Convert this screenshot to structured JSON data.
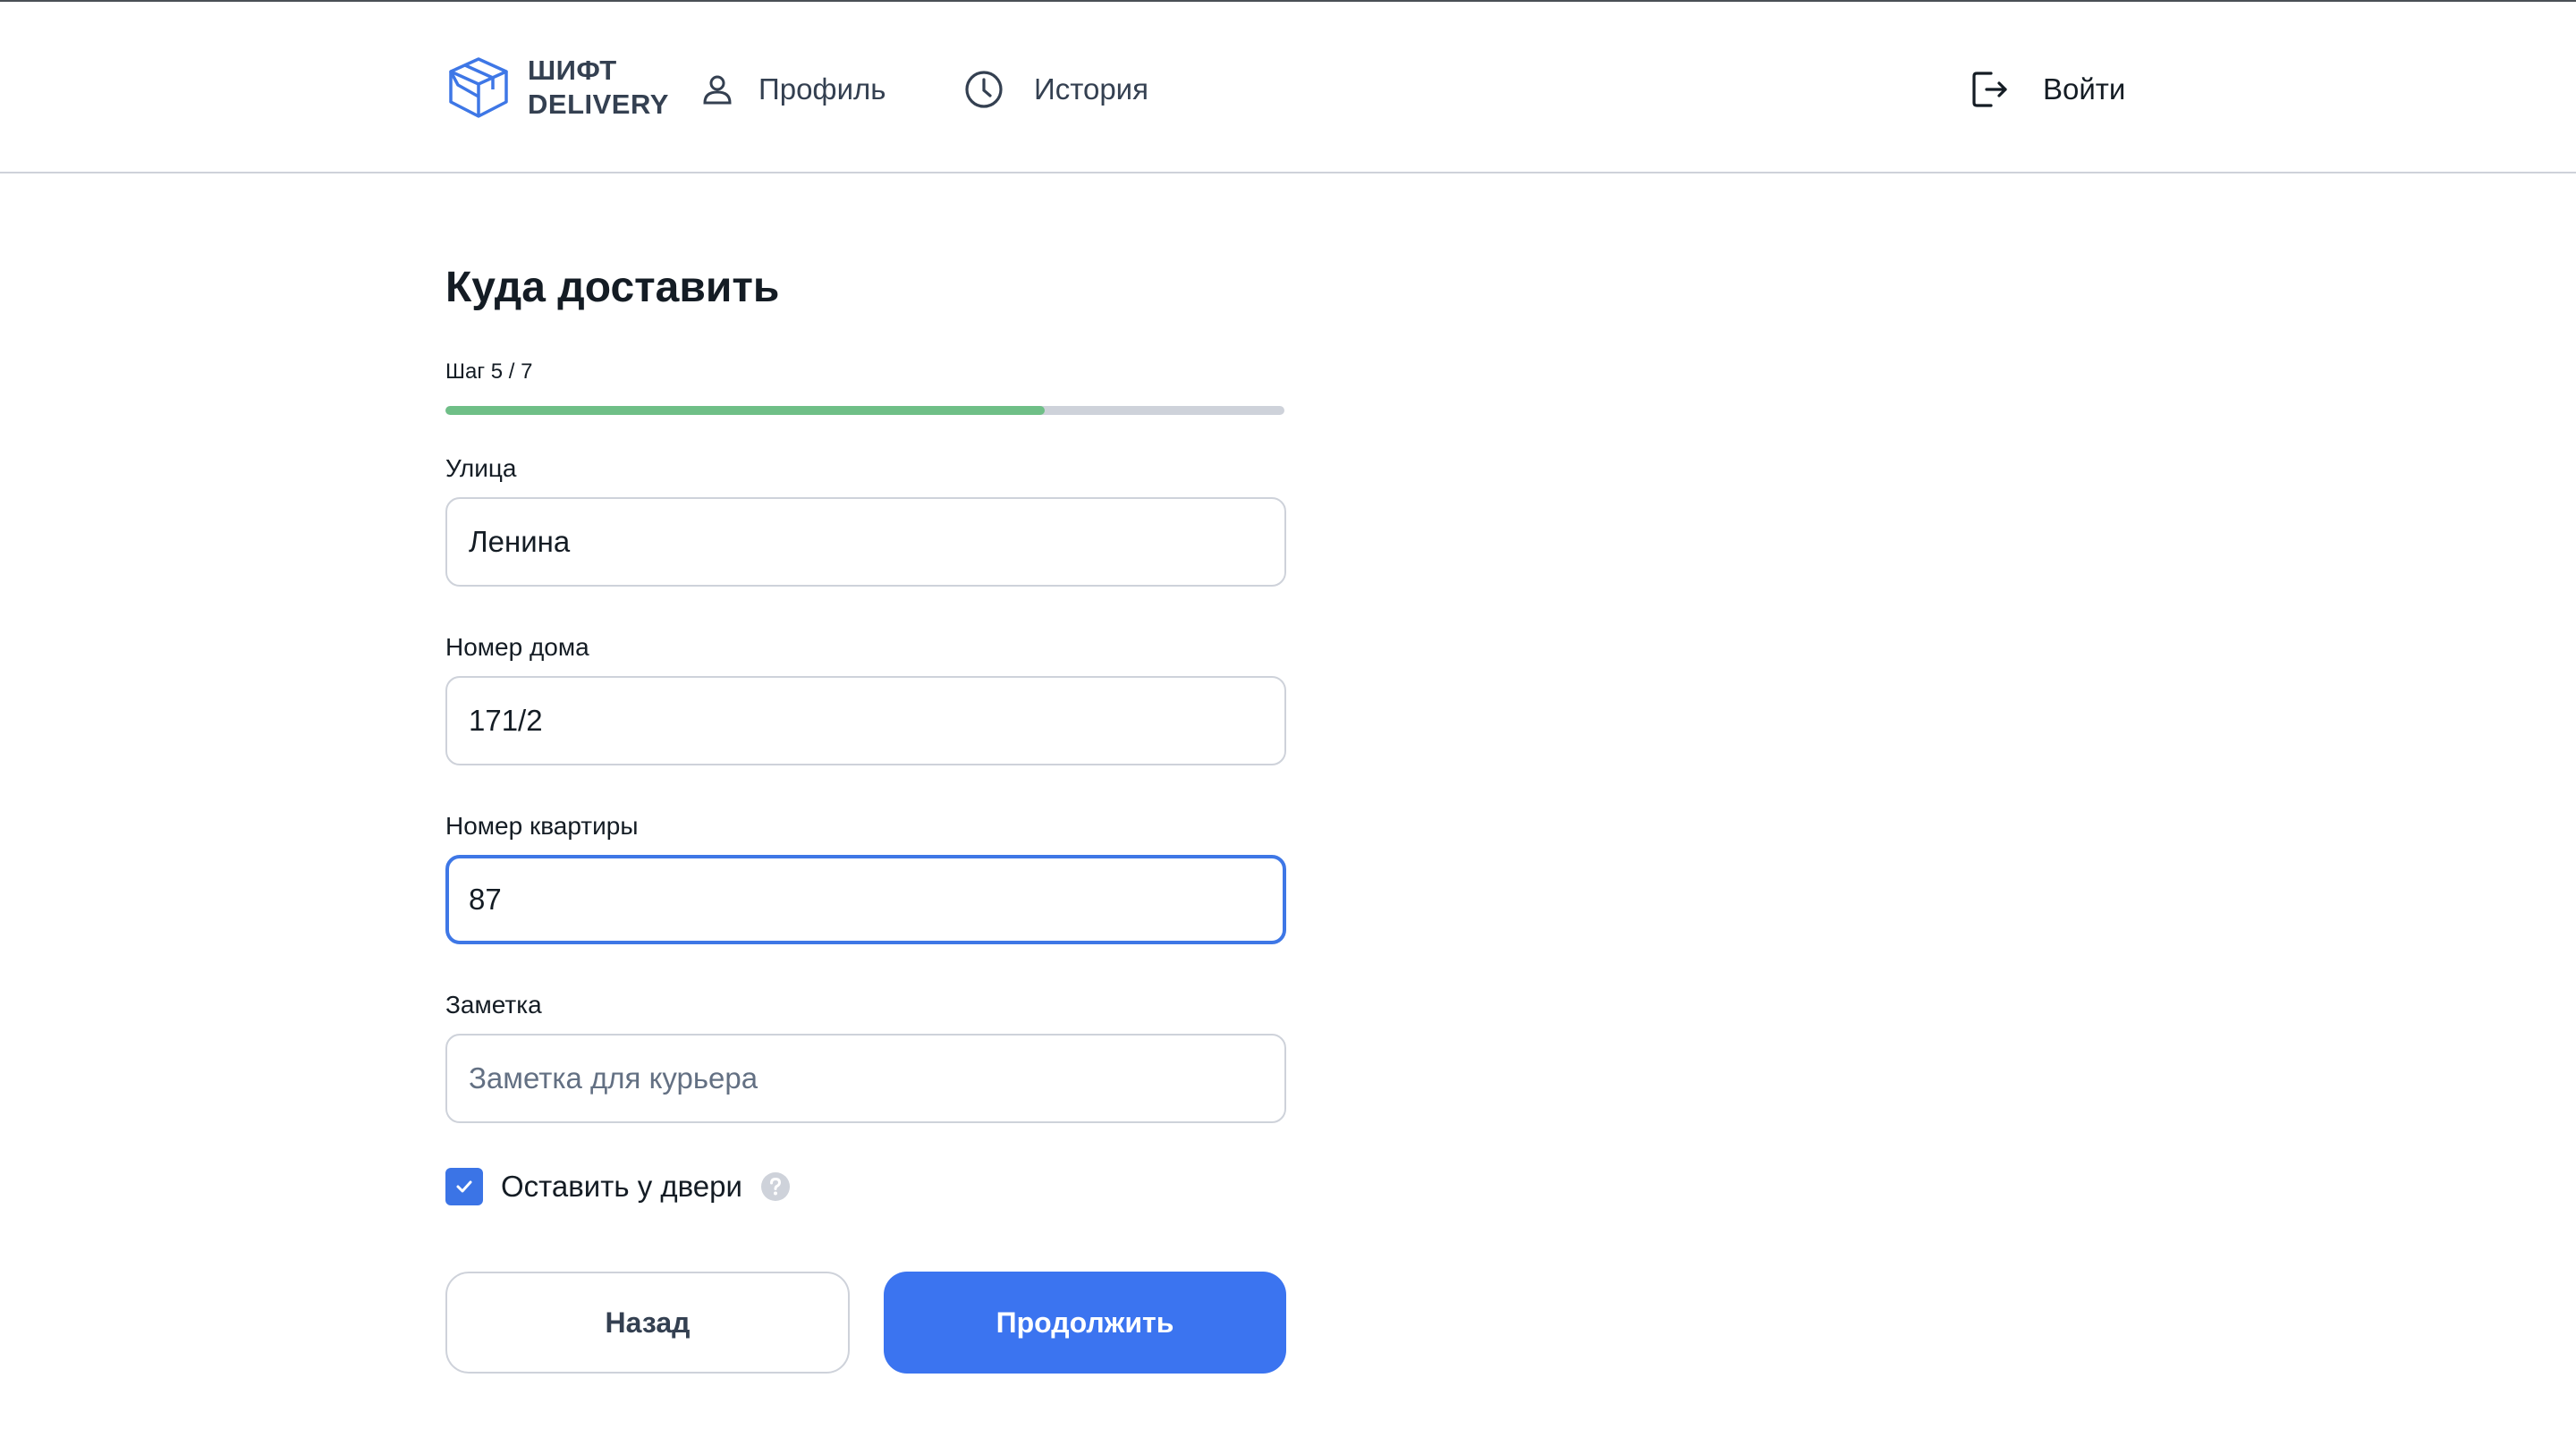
{
  "header": {
    "brand_line1": "ШИФТ",
    "brand_line2": "DELIVERY",
    "nav": {
      "profile_label": "Профиль",
      "history_label": "История",
      "login_label": "Войти"
    }
  },
  "form": {
    "title": "Куда доставить",
    "step_label": "Шаг 5 / 7",
    "progress_fraction": 0.714,
    "street": {
      "label": "Улица",
      "value": "Ленина"
    },
    "house": {
      "label": "Номер дома",
      "value": "171/2"
    },
    "apartment": {
      "label": "Номер квартиры",
      "value": "87"
    },
    "note": {
      "label": "Заметка",
      "value": "",
      "placeholder": "Заметка для курьера"
    },
    "leave_at_door": {
      "label": "Оставить у двери",
      "checked": true
    },
    "back_label": "Назад",
    "continue_label": "Продолжить"
  },
  "colors": {
    "accent": "#3b74f0",
    "progress": "#6fbf87",
    "border": "#ced2da",
    "text": "#141c24"
  },
  "icons": {
    "logo": "box-icon",
    "profile": "user-icon",
    "history": "clock-icon",
    "login": "exit-icon",
    "help": "question-icon",
    "checkbox": "check-icon"
  }
}
